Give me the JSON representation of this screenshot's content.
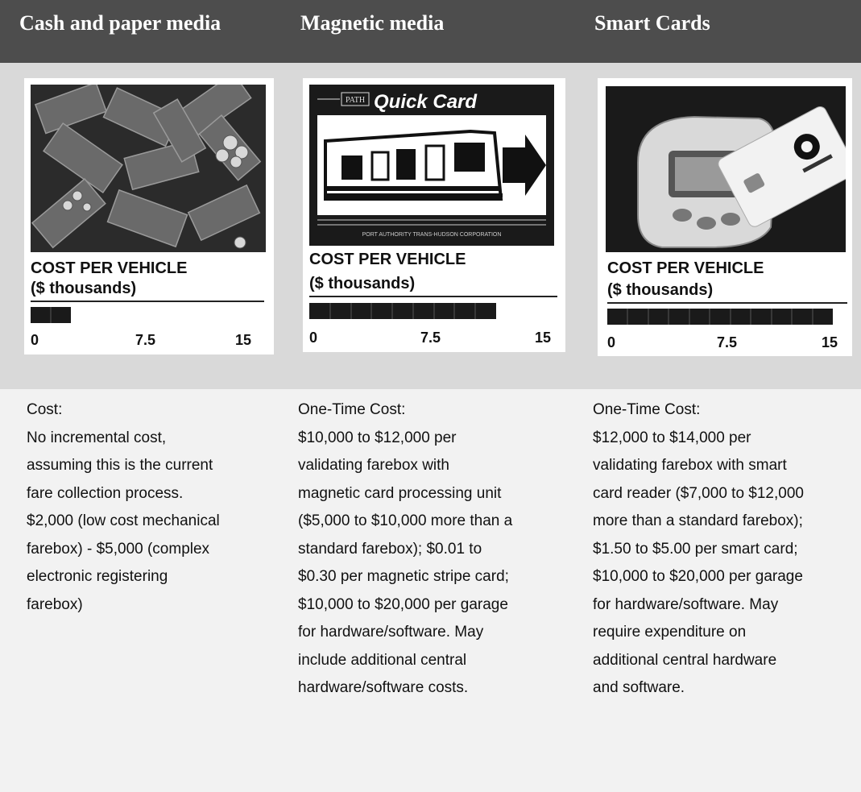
{
  "columns": [
    {
      "title": "Cash and paper media",
      "cost_label_1": "COST PER VEHICLE",
      "cost_label_2": "($ thousands)",
      "bar_segments": 2,
      "axis": [
        "0",
        "7.5",
        "15"
      ],
      "description": [
        "Cost:",
        "No incremental cost,",
        "assuming this is the current",
        "fare collection process.",
        "$2,000 (low cost mechanical",
        "farebox) - $5,000 (complex",
        "electronic registering",
        "farebox)"
      ]
    },
    {
      "title": "Magnetic media",
      "card_brand": "PATH",
      "card_name": "Quick Card",
      "card_footer": "PORT AUTHORITY TRANS-HUDSON CORPORATION",
      "cost_label_1": "COST PER VEHICLE",
      "cost_label_2": "($ thousands)",
      "bar_segments": 9,
      "axis": [
        "0",
        "7.5",
        "15"
      ],
      "description": [
        "One-Time Cost:",
        "$10,000 to $12,000 per",
        "validating farebox with",
        "magnetic card processing unit",
        "($5,000 to $10,000 more than a",
        "standard farebox); $0.01 to",
        "$0.30 per magnetic stripe card;",
        "$10,000 to $20,000 per garage",
        "for hardware/software. May",
        "include additional central",
        "hardware/software costs."
      ]
    },
    {
      "title": "Smart Cards",
      "cost_label_1": "COST PER VEHICLE",
      "cost_label_2": "($ thousands)",
      "bar_segments": 11,
      "axis": [
        "0",
        "7.5",
        "15"
      ],
      "description": [
        "One-Time Cost:",
        "$12,000 to $14,000 per",
        "validating farebox with smart",
        "card reader ($7,000 to $12,000",
        "more than a standard farebox);",
        "$1.50 to $5.00 per smart card;",
        "$10,000 to $20,000 per garage",
        "for hardware/software. May",
        "require expenditure on",
        "additional central hardware",
        "and software."
      ]
    }
  ]
}
